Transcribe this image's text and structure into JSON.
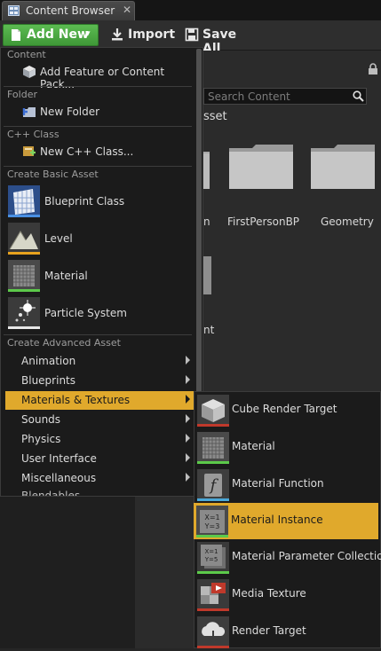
{
  "tab": {
    "title": "Content Browser",
    "close": "✕",
    "icon": "content-browser-icon"
  },
  "toolbar": {
    "add_new": "Add New",
    "import": "Import",
    "save_all": "Save All"
  },
  "search": {
    "placeholder": "Search Content"
  },
  "breadcrumb_tail": "sset",
  "folders": [
    {
      "label": "FirstPersonBP"
    },
    {
      "label": "Geometry"
    }
  ],
  "partial_labels": {
    "left_folder": "n",
    "left_tile": "nt"
  },
  "menu": {
    "sections": {
      "content": "Content",
      "folder": "Folder",
      "cpp": "C++ Class",
      "basic": "Create Basic Asset",
      "advanced": "Create Advanced Asset"
    },
    "add_feature": "Add Feature or Content Pack...",
    "new_folder": "New Folder",
    "new_cpp": "New C++ Class...",
    "basic_assets": [
      {
        "label": "Blueprint Class",
        "underline": "#4a90e2"
      },
      {
        "label": "Level",
        "underline": "#e8a21e"
      },
      {
        "label": "Material",
        "underline": "#5cc94a"
      },
      {
        "label": "Particle System",
        "underline": "#e8e8e8"
      }
    ],
    "advanced_items": [
      {
        "label": "Animation"
      },
      {
        "label": "Blueprints"
      },
      {
        "label": "Materials & Textures",
        "highlighted": true
      },
      {
        "label": "Sounds"
      },
      {
        "label": "Physics"
      },
      {
        "label": "User Interface"
      },
      {
        "label": "Miscellaneous"
      }
    ],
    "cut_item": "Blendables"
  },
  "submenu": {
    "items": [
      {
        "label": "Cube Render Target",
        "underline": "#c0392b"
      },
      {
        "label": "Material",
        "underline": "#5cc94a"
      },
      {
        "label": "Material Function",
        "underline": "#4aa8d8"
      },
      {
        "label": "Material Instance",
        "highlighted": true,
        "underline": "#5cc94a"
      },
      {
        "label": "Material Parameter Collection",
        "underline": "#5cc94a"
      },
      {
        "label": "Media Texture",
        "underline": "#c0392b"
      },
      {
        "label": "Render Target",
        "underline": "#c0392b"
      }
    ]
  },
  "colors": {
    "highlight": "#e0a92c",
    "add_new_green": "#4ea843",
    "menu_bg": "#1b1b1b"
  }
}
